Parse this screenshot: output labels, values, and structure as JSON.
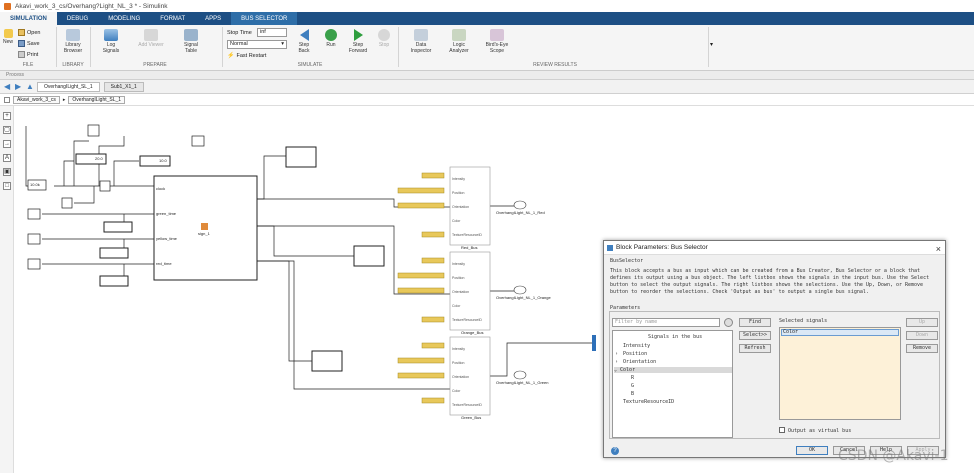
{
  "window": {
    "title": "Akavi_work_3_cs/Overhang?Light_NL_3 * - Simulink"
  },
  "tabs": [
    "SIMULATION",
    "DEBUG",
    "MODELING",
    "FORMAT",
    "APPS",
    "BUS SELECTOR"
  ],
  "toolstrip": {
    "file": {
      "new": "New",
      "open": "Open",
      "save": "Save",
      "print": "Print",
      "section": "FILE"
    },
    "library": {
      "browser": "Library Browser",
      "section": "LIBRARY"
    },
    "prepare": {
      "log": "Log Signals",
      "viewer": "Add Viewer",
      "table": "Signal Table",
      "section": "PREPARE"
    },
    "simulate": {
      "stop_time_label": "Stop Time",
      "stop_time_value": "inf",
      "mode": "Normal",
      "fast_restart": "Fast Restart",
      "step_back": "Step Back",
      "run": "Run",
      "step_forward": "Step Forward",
      "stop": "Stop",
      "section": "SIMULATE"
    },
    "review": {
      "data_inspector": "Data Inspector",
      "logic_analyzer": "Logic Analyzer",
      "birds_eye": "Bird's-Eye Scope",
      "section": "REVIEW RESULTS"
    }
  },
  "prepare_strip": "Process",
  "doc_tabs": [
    "OverhangILight_SL_1",
    "Sub1_X1_1"
  ],
  "breadcrumb": [
    "Akavi_work_3_cs",
    "OverhangILight_SL_1"
  ],
  "canvas": {
    "const_value": "10.0k",
    "bus_labels": [
      "Red_Bus",
      "Orange_Bus",
      "Green_Bus"
    ],
    "outputs": [
      "OverhangILight_NL_1_Red",
      "OverhangILight_NL_1_Orange",
      "OverhangILight_NL_1_Green"
    ],
    "port_labels": [
      "Intensity",
      "Position",
      "Orientation",
      "Color",
      "TextureResourceID"
    ],
    "subsystem_inputs": [
      "clock",
      "green_time",
      "yellow_time",
      "red_time"
    ],
    "subsystem_name": "sign_1",
    "display_values": [
      "20.0",
      "10.0"
    ]
  },
  "dialog": {
    "title": "Block Parameters: Bus Selector",
    "block_type": "BusSelector",
    "description": "This block accepts a bus as input which can be created from a Bus Creator, Bus Selector or a block that defines its output using a bus object. The left listbox shows the signals in the input bus. Use the Select button to select the output signals. The right listbox shows the selections. Use the Up, Down, or Remove button to reorder the selections. Check 'Output as bus' to output a single bus signal.",
    "params_label": "Parameters",
    "filter_placeholder": "Filter by name",
    "signals_header": "Signals in the bus",
    "signals": [
      "Intensity",
      "Position",
      "Orientation",
      "Color",
      "R",
      "G",
      "B",
      "TextureResourceID"
    ],
    "buttons": {
      "find": "Find",
      "select": "Select>>",
      "refresh": "Refresh",
      "up": "Up",
      "down": "Down",
      "remove": "Remove"
    },
    "selected_header": "Selected signals",
    "selected": [
      "Color"
    ],
    "virtual_bus": "Output as virtual bus",
    "footer": {
      "ok": "OK",
      "cancel": "Cancel",
      "help": "Help",
      "apply": "Apply"
    }
  },
  "watermark": "CSDN @Akavi-1"
}
